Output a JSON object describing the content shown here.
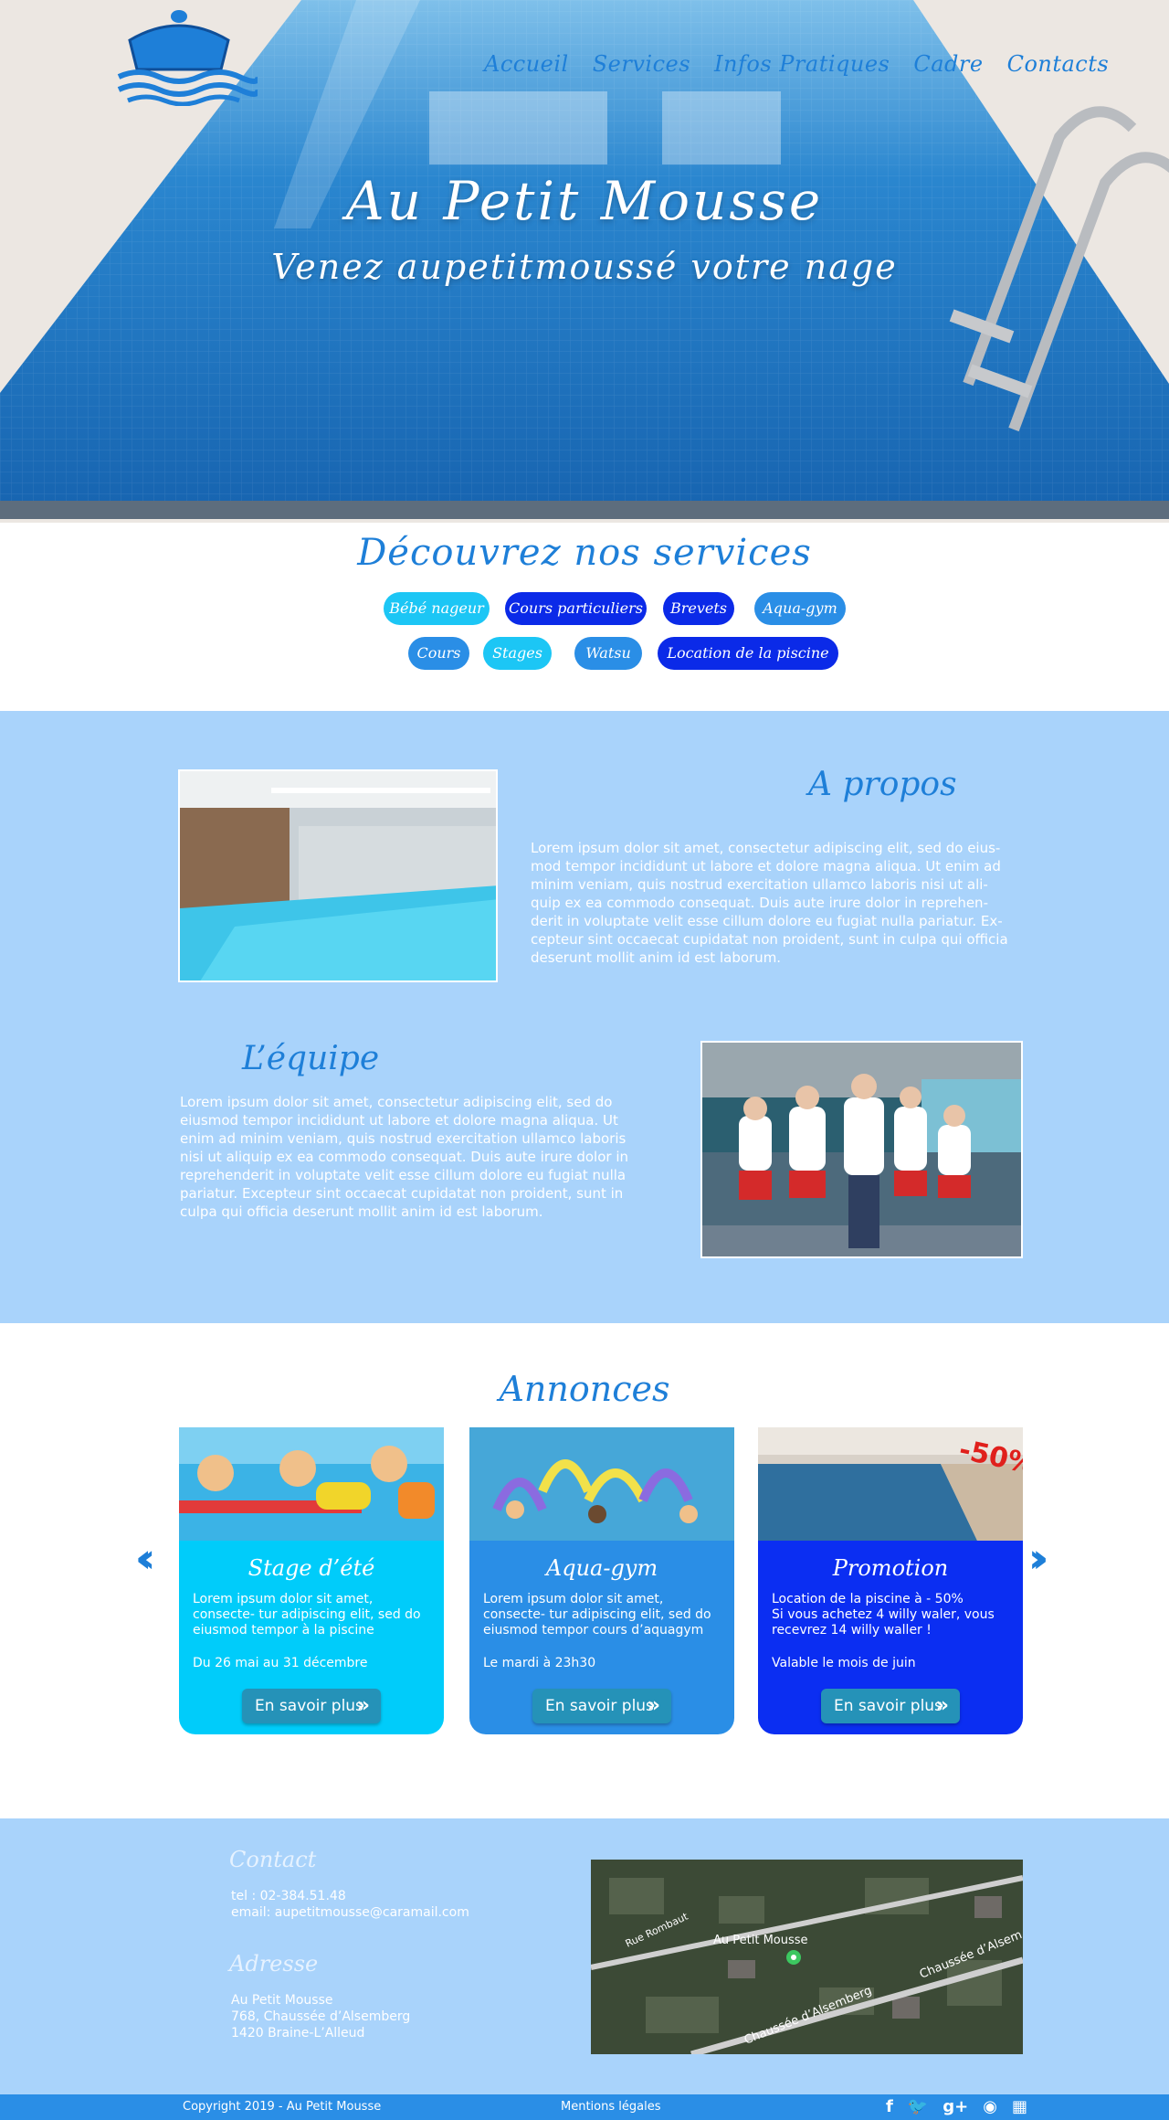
{
  "nav": {
    "items": [
      {
        "label": "Accueil"
      },
      {
        "label": "Services"
      },
      {
        "label": "Infos Pratiques"
      },
      {
        "label": "Cadre"
      },
      {
        "label": "Contacts"
      }
    ],
    "color": "#1e7fd8"
  },
  "hero": {
    "title": "Au Petit Mousse",
    "subtitle": "Venez aupetitmoussé votre nage"
  },
  "services": {
    "title": "Découvrez nos services",
    "pills": [
      {
        "label": "Bébé nageur",
        "color": "#1cc6f5"
      },
      {
        "label": "Cours particuliers",
        "color": "#0b2ae8"
      },
      {
        "label": "Brevets",
        "color": "#0b2ae8"
      },
      {
        "label": "Aqua-gym",
        "color": "#2a8ee6"
      },
      {
        "label": "Cours",
        "color": "#2a8ee6"
      },
      {
        "label": "Stages",
        "color": "#1cc6f5"
      },
      {
        "label": "Watsu",
        "color": "#2a8ee6"
      },
      {
        "label": "Location de la piscine",
        "color": "#0b2ae8"
      }
    ]
  },
  "about": {
    "title": "A propos",
    "text": "Lorem ipsum dolor sit amet, consectetur adipiscing elit, sed do eius- mod tempor incididunt ut labore et dolore magna aliqua. Ut enim ad minim veniam, quis nostrud exercitation ullamco laboris nisi ut ali- quip ex ea commodo consequat. Duis aute irure dolor in reprehen- derit in voluptate velit esse cillum dolore eu fugiat nulla pariatur. Ex- cepteur sint occaecat cupidatat non proident, sunt in culpa qui officia deserunt mollit anim id est laborum."
  },
  "team": {
    "title": "L’équipe",
    "text": "Lorem ipsum dolor sit amet, consectetur adipiscing elit, sed do eiusmod tempor incididunt ut labore et dolore magna aliqua. Ut enim ad minim veniam, quis nostrud exercitation ullamco laboris nisi ut aliquip ex ea commodo consequat. Duis aute irure dolor in reprehenderit in voluptate velit esse cillum dolore eu fugiat nulla pariatur. Excepteur sint occaecat cupidatat non proident, sunt in culpa qui officia deserunt mollit anim id est laborum."
  },
  "annonces": {
    "title": "Annonces",
    "cards": [
      {
        "title": "Stage d’été",
        "text": "Lorem ipsum dolor sit amet, consecte- tur adipiscing elit, sed do eiusmod tempor à la piscine",
        "date": "Du 26 mai au 31 décembre",
        "button": "En savoir plus",
        "color": "#00ccfa"
      },
      {
        "title": "Aqua-gym",
        "text": "Lorem ipsum dolor sit amet, consecte- tur adipiscing elit, sed do eiusmod tempor cours d’aquagym",
        "date": "Le mardi à 23h30",
        "button": "En savoir plus",
        "color": "#2a8ee6"
      },
      {
        "title": "Promotion",
        "text": "Location de la piscine à - 50%\nSi vous achetez 4 willy waler, vous recevrez 14 willy waller !",
        "date": "Valable le mois de juin",
        "button": "En savoir plus",
        "color": "#0b2ef2",
        "badge": "-50%"
      }
    ],
    "prev_icon": "double-chevron-left-icon",
    "next_icon": "double-chevron-right-icon"
  },
  "contact": {
    "title": "Contact",
    "phone": "tel : 02-384.51.48",
    "email": "email: aupetitmousse@caramail.com"
  },
  "address": {
    "title": "Adresse",
    "name": "Au Petit Mousse",
    "street": "768, Chaussée d’Alsemberg",
    "city": "1420 Braine-L’Alleud"
  },
  "map": {
    "pin_label": "Au Petit Mousse",
    "road1": "Rue Rombaut",
    "road2": "Chaussée d’Alsemberg",
    "road3": "Chaussée d’Alsem"
  },
  "footer": {
    "copyright": "Copyright 2019 - Au Petit Mousse",
    "legal": "Mentions légales",
    "social": [
      "facebook-icon",
      "twitter-icon",
      "google-plus-icon",
      "rss-icon",
      "myspace-icon"
    ]
  }
}
